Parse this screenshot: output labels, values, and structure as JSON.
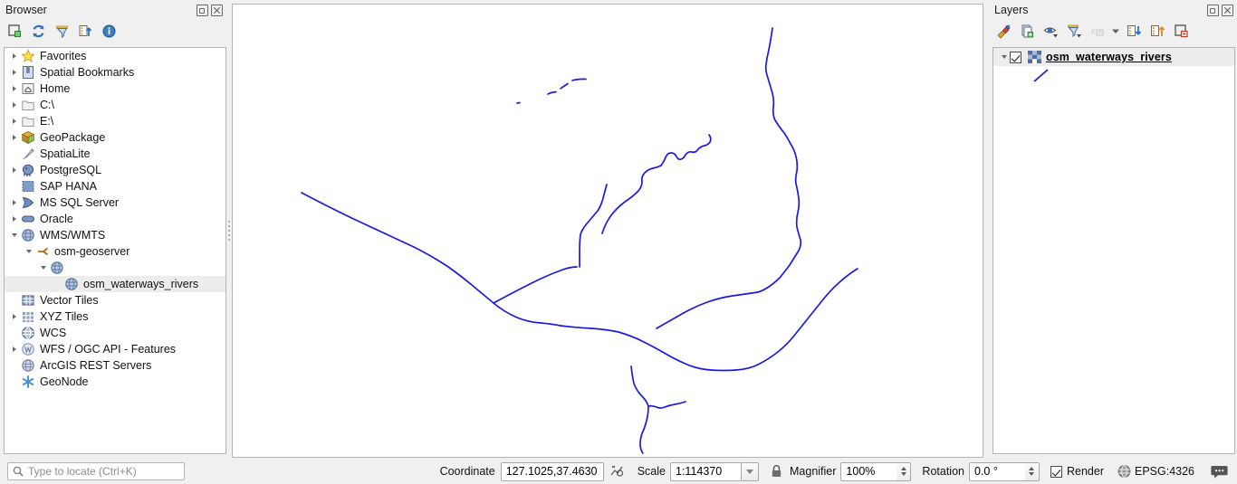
{
  "browser": {
    "title": "Browser",
    "window_buttons": [
      {
        "name": "float-button",
        "label": ""
      },
      {
        "name": "close-button",
        "label": ""
      }
    ],
    "toolbar": [
      {
        "name": "add-layer-icon",
        "tooltip": "Add Selected Layers"
      },
      {
        "name": "refresh-icon",
        "tooltip": "Refresh"
      },
      {
        "name": "filter-icon",
        "tooltip": "Filter Browser"
      },
      {
        "name": "collapse-all-icon",
        "tooltip": "Collapse All"
      },
      {
        "name": "properties-icon",
        "tooltip": "Enable/disable properties widget"
      }
    ],
    "items": [
      {
        "label": "Favorites",
        "icon": "star-icon",
        "indent": 0,
        "expandable": true,
        "expanded": false,
        "selected": false
      },
      {
        "label": "Spatial Bookmarks",
        "icon": "bookmark-icon",
        "indent": 0,
        "expandable": true,
        "expanded": false,
        "selected": false
      },
      {
        "label": "Home",
        "icon": "home-icon",
        "indent": 0,
        "expandable": true,
        "expanded": false,
        "selected": false
      },
      {
        "label": "C:\\",
        "icon": "folder-icon",
        "indent": 0,
        "expandable": true,
        "expanded": false,
        "selected": false
      },
      {
        "label": "E:\\",
        "icon": "folder-icon",
        "indent": 0,
        "expandable": true,
        "expanded": false,
        "selected": false
      },
      {
        "label": "GeoPackage",
        "icon": "geopackage-icon",
        "indent": 0,
        "expandable": true,
        "expanded": false,
        "selected": false
      },
      {
        "label": "SpatiaLite",
        "icon": "spatialite-icon",
        "indent": 0,
        "expandable": false,
        "expanded": false,
        "selected": false
      },
      {
        "label": "PostgreSQL",
        "icon": "postgres-elephant-icon",
        "indent": 0,
        "expandable": true,
        "expanded": false,
        "selected": false
      },
      {
        "label": "SAP HANA",
        "icon": "sap-hana-icon",
        "indent": 0,
        "expandable": false,
        "expanded": false,
        "selected": false
      },
      {
        "label": "MS SQL Server",
        "icon": "mssql-icon",
        "indent": 0,
        "expandable": true,
        "expanded": false,
        "selected": false
      },
      {
        "label": "Oracle",
        "icon": "oracle-icon",
        "indent": 0,
        "expandable": true,
        "expanded": false,
        "selected": false
      },
      {
        "label": "WMS/WMTS",
        "icon": "globe-icon",
        "indent": 0,
        "expandable": true,
        "expanded": true,
        "selected": false
      },
      {
        "label": "osm-geoserver",
        "icon": "connection-icon",
        "indent": 1,
        "expandable": true,
        "expanded": true,
        "selected": false
      },
      {
        "label": "",
        "icon": "globe-icon",
        "indent": 2,
        "expandable": true,
        "expanded": true,
        "selected": false
      },
      {
        "label": "osm_waterways_rivers",
        "icon": "globe-icon",
        "indent": 3,
        "expandable": false,
        "expanded": false,
        "selected": true
      },
      {
        "label": "Vector Tiles",
        "icon": "vector-tiles-icon",
        "indent": 0,
        "expandable": false,
        "expanded": false,
        "selected": false
      },
      {
        "label": "XYZ Tiles",
        "icon": "xyz-tiles-icon",
        "indent": 0,
        "expandable": true,
        "expanded": false,
        "selected": false
      },
      {
        "label": "WCS",
        "icon": "wcs-globe-icon",
        "indent": 0,
        "expandable": false,
        "expanded": false,
        "selected": false
      },
      {
        "label": "WFS / OGC API - Features",
        "icon": "wfs-icon",
        "indent": 0,
        "expandable": true,
        "expanded": false,
        "selected": false
      },
      {
        "label": "ArcGIS REST Servers",
        "icon": "arcgis-icon",
        "indent": 0,
        "expandable": false,
        "expanded": false,
        "selected": false
      },
      {
        "label": "GeoNode",
        "icon": "geonode-icon",
        "indent": 0,
        "expandable": false,
        "expanded": false,
        "selected": false
      }
    ]
  },
  "layers": {
    "title": "Layers",
    "toolbar": [
      {
        "name": "open-layer-styling-icon",
        "tooltip": "Open the Layer Styling panel"
      },
      {
        "name": "add-group-icon",
        "tooltip": "Add Group"
      },
      {
        "name": "manage-visibility-icon",
        "tooltip": "Manage Map Themes"
      },
      {
        "name": "filter-legend-icon",
        "tooltip": "Filter Legend"
      },
      {
        "name": "filter-expression-icon",
        "tooltip": "Filter Legend by Expression"
      },
      {
        "name": "expand-all-icon",
        "tooltip": "Expand All"
      },
      {
        "name": "collapse-all-icon",
        "tooltip": "Collapse All"
      },
      {
        "name": "remove-layer-icon",
        "tooltip": "Remove Layer/Group"
      }
    ],
    "items": [
      {
        "name": "osm_waterways_rivers",
        "checked": true,
        "expanded": true,
        "symbol_color": "#2222dd"
      }
    ]
  },
  "map": {
    "background": "#ffffff",
    "river_color": "#1a1ae6",
    "river_width": 1.6
  },
  "statusbar": {
    "locator_placeholder": "Type to locate (Ctrl+K)",
    "coordinate_label": "Coordinate",
    "coordinate_value": "127.1025,37.4630",
    "scale_label": "Scale",
    "scale_value": "1:114370",
    "magnifier_label": "Magnifier",
    "magnifier_value": "100%",
    "rotation_label": "Rotation",
    "rotation_value": "0.0 °",
    "render_label": "Render",
    "render_checked": true,
    "crs_value": "EPSG:4326",
    "icons": {
      "locator": "search-icon",
      "coordinate_toggle": "extent-toggle-icon",
      "lock_scale": "lock-icon",
      "crs": "crs-globe-icon",
      "messages": "messages-icon"
    }
  }
}
